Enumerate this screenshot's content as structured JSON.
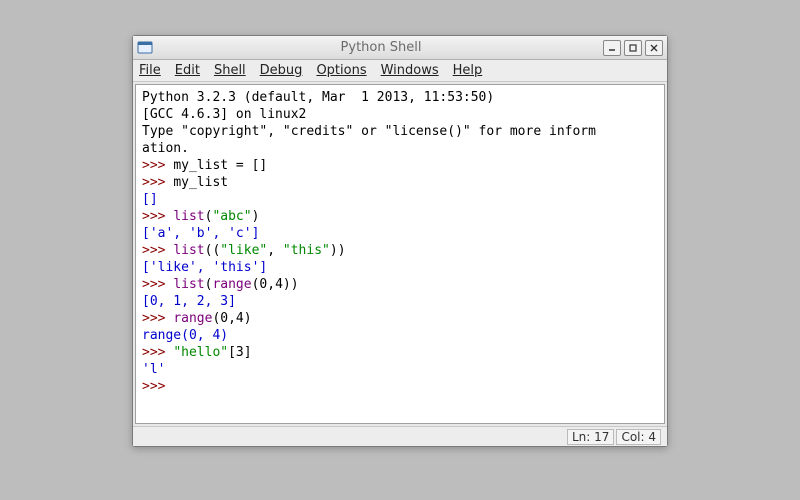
{
  "window": {
    "title": "Python Shell"
  },
  "menu": {
    "file": "File",
    "edit": "Edit",
    "shell": "Shell",
    "debug": "Debug",
    "options": "Options",
    "windows": "Windows",
    "help": "Help"
  },
  "shell": {
    "banner1": "Python 3.2.3 (default, Mar  1 2013, 11:53:50)",
    "banner2": "[GCC 4.6.3] on linux2",
    "banner3": "Type \"copyright\", \"credits\" or \"license()\" for more inform",
    "banner3b": "ation.",
    "prompt": ">>> ",
    "l1_code": "my_list = []",
    "l2_code": "my_list",
    "l2_out": "[]",
    "l3_code_a": "list",
    "l3_code_b": "(",
    "l3_code_c": "\"abc\"",
    "l3_code_d": ")",
    "l3_out": "['a', 'b', 'c']",
    "l4_code_a": "list",
    "l4_code_b": "((",
    "l4_code_c": "\"like\"",
    "l4_code_d": ", ",
    "l4_code_e": "\"this\"",
    "l4_code_f": "))",
    "l4_out": "['like', 'this']",
    "l5_code_a": "list",
    "l5_code_b": "(",
    "l5_code_c": "range",
    "l5_code_d": "(0,4))",
    "l5_out": "[0, 1, 2, 3]",
    "l6_code_a": "range",
    "l6_code_b": "(0,4)",
    "l6_out": "range(0, 4)",
    "l7_code_a": "\"hello\"",
    "l7_code_b": "[3]",
    "l7_out": "'l'"
  },
  "status": {
    "ln_label": "Ln: ",
    "ln": "17",
    "col_label": "Col: ",
    "col": "4"
  }
}
